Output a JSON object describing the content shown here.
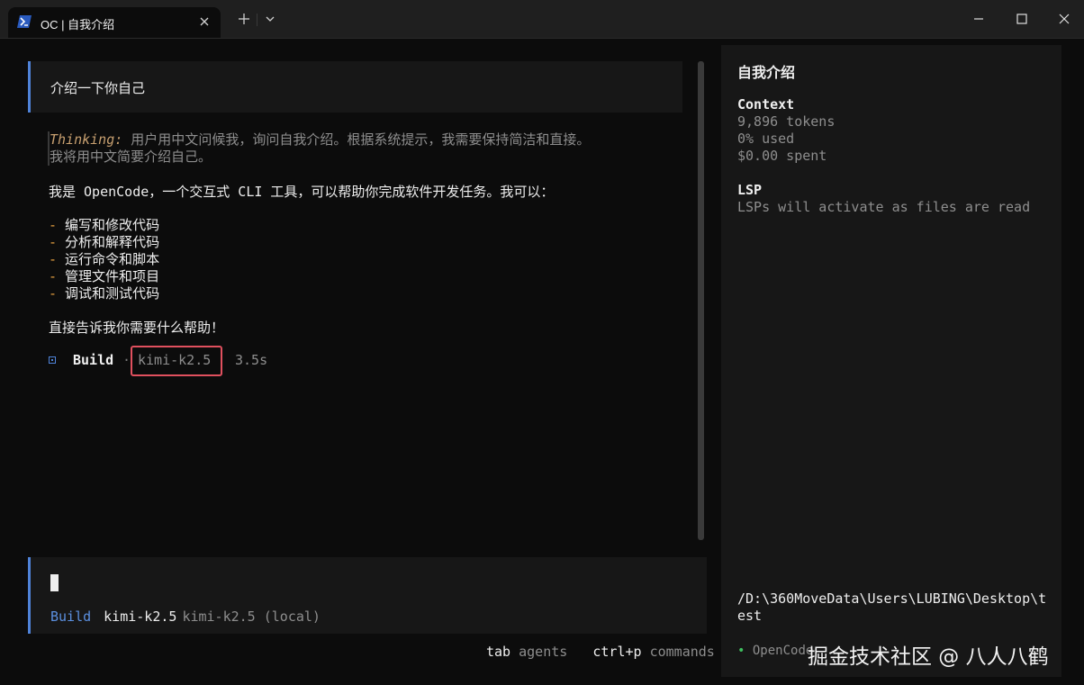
{
  "window": {
    "tab_title": "OC | 自我介绍",
    "tab_icon": "powershell-icon",
    "accent": "#4f83d9"
  },
  "conversation": {
    "user_message": "介绍一下你自己",
    "thinking_label": "Thinking:",
    "thinking_line1": " 用户用中文问候我，询问自我介绍。根据系统提示，我需要保持简洁和直接。",
    "thinking_line2": "我将用中文简要介绍自己。",
    "intro": "我是 OpenCode，一个交互式 CLI 工具，可以帮助你完成软件开发任务。我可以：",
    "list": [
      {
        "dash": "-",
        "text": " 编写和修改代码"
      },
      {
        "dash": "-",
        "text": " 分析和解释代码"
      },
      {
        "dash": "-",
        "text": " 运行命令和脚本"
      },
      {
        "dash": "-",
        "text": " 管理文件和项目"
      },
      {
        "dash": "-",
        "text": " 调试和测试代码"
      }
    ],
    "closing": "直接告诉我你需要什么帮助！",
    "build": {
      "agent": "Build",
      "separator": "·",
      "model": "kimi-k2.5",
      "duration": "3.5s"
    }
  },
  "prompt": {
    "agent": "Build",
    "model": "kimi-k2.5",
    "provider": "kimi-k2.5 (local)"
  },
  "shortcuts": {
    "tab_key": "tab",
    "tab_desc": "agents",
    "cmd_key": "ctrl+p",
    "cmd_desc": "commands"
  },
  "sidebar": {
    "title": "自我介绍",
    "context_heading": "Context",
    "tokens": "9,896 tokens",
    "used": "0% used",
    "spent": "$0.00 spent",
    "lsp_heading": "LSP",
    "lsp_text": "LSPs will activate as files are read",
    "path": "/D:\\360MoveData\\Users\\LUBING\\Desktop\\test",
    "status_dot": "•",
    "status_text": "OpenCode"
  },
  "watermark": "掘金技术社区 @ 八人八鹤"
}
